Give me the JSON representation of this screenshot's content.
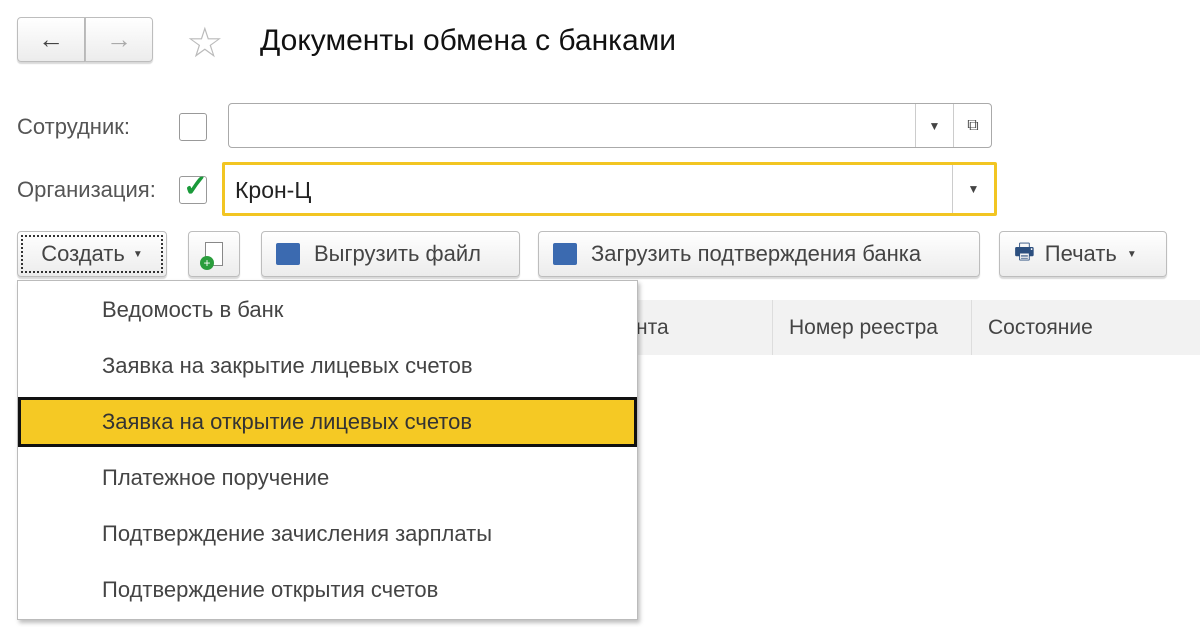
{
  "header": {
    "title": "Документы обмена с банками",
    "back_icon": "←",
    "forward_icon": "→",
    "star_icon": "☆"
  },
  "filters": {
    "employee": {
      "label": "Сотрудник:",
      "checked": false,
      "value": ""
    },
    "organization": {
      "label": "Организация:",
      "checked": true,
      "value": "Крон-Ц"
    }
  },
  "toolbar": {
    "create": "Создать",
    "export": "Выгрузить файл",
    "import": "Загрузить подтверждения банка",
    "print": "Печать"
  },
  "table": {
    "columns": [
      "нта",
      "Номер реестра",
      "Состояние"
    ]
  },
  "create_menu": {
    "items": [
      "Ведомость в банк",
      "Заявка на закрытие лицевых счетов",
      "Заявка на открытие лицевых счетов",
      "Платежное поручение",
      "Подтверждение зачисления зарплаты",
      "Подтверждение открытия счетов"
    ],
    "selected_index": 2
  },
  "colors": {
    "accent": "#f5c924",
    "check": "#1a9a3a"
  }
}
